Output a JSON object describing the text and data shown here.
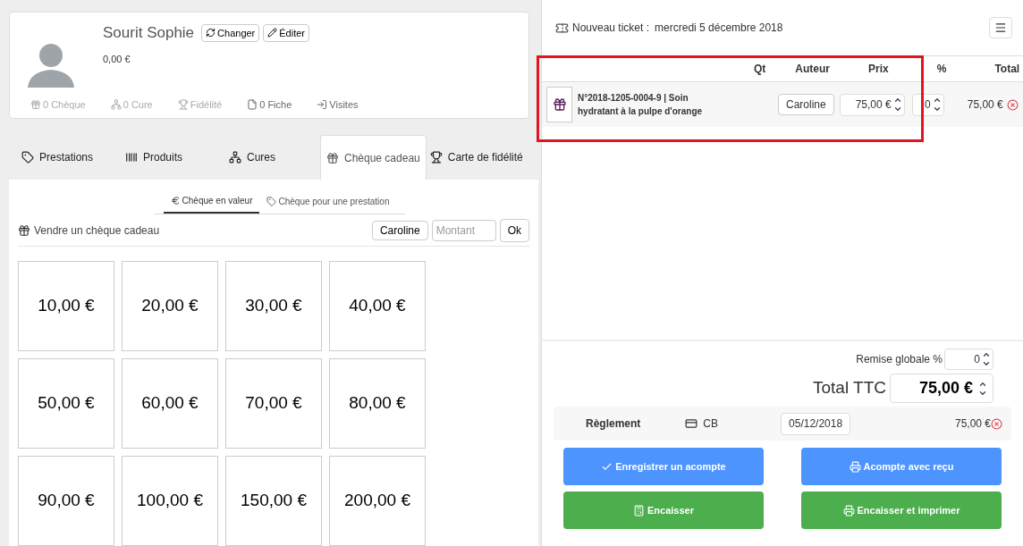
{
  "client": {
    "name": "Sourit Sophie",
    "balance": "0,00 €",
    "buttons": [
      {
        "kind": "change",
        "label": "Changer"
      },
      {
        "kind": "edit",
        "label": "Éditer"
      }
    ],
    "stats": [
      {
        "kind": "gift",
        "label": "0 Chèque",
        "disabled": true
      },
      {
        "kind": "tree",
        "label": "0 Cure",
        "disabled": true
      },
      {
        "kind": "trophy",
        "label": "Fidélité",
        "disabled": true
      },
      {
        "kind": "file",
        "label": "0 Fiche",
        "disabled": false
      },
      {
        "kind": "enter",
        "label": "Visites",
        "disabled": false
      }
    ]
  },
  "tabs": [
    {
      "kind": "tag",
      "label": "Prestations",
      "selected": false
    },
    {
      "kind": "barcode",
      "label": "Produits",
      "selected": false
    },
    {
      "kind": "tree",
      "label": "Cures",
      "selected": false
    },
    {
      "kind": "gift",
      "label": "Chèque cadeau",
      "selected": true
    },
    {
      "kind": "trophy",
      "label": "Carte de fidélité",
      "selected": false
    }
  ],
  "subtabs": [
    {
      "kind": "euro",
      "label": "Chèque en valeur",
      "selected": true
    },
    {
      "kind": "tag",
      "label": "Chèque pour une prestation",
      "selected": false
    }
  ],
  "sell": {
    "title": "Vendre un chèque cadeau",
    "author": "Caroline",
    "amount_placeholder": "Montant",
    "ok": "Ok"
  },
  "amounts": [
    "10,00 €",
    "20,00 €",
    "30,00 €",
    "40,00 €",
    "50,00 €",
    "60,00 €",
    "70,00 €",
    "80,00 €",
    "90,00 €",
    "100,00 €",
    "150,00 €",
    "200,00 €"
  ],
  "ticket": {
    "title": "Nouveau ticket :",
    "date": "mercredi 5 décembre 2018",
    "columns": [
      "Qt",
      "Auteur",
      "Prix",
      "%",
      "Total"
    ],
    "rows": [
      {
        "label": "N°2018-1205-0004-9 | Soin hydratant à la pulpe d'orange",
        "author": "Caroline",
        "price": "75,00 €",
        "discount": "0",
        "total": "75,00 €"
      }
    ]
  },
  "summary": {
    "discount_label": "Remise globale %",
    "discount": "0",
    "total_label": "Total TTC",
    "total": "75,00 €"
  },
  "payment": {
    "label": "Règlement",
    "method": "CB",
    "date": "05/12/2018",
    "amount": "75,00 €"
  },
  "actions": [
    {
      "kind": "deposit",
      "label": "Enregistrer un acompte"
    },
    {
      "kind": "deposit_print",
      "label": "Acompte avec reçu"
    },
    {
      "kind": "cash",
      "label": "Encaisser"
    },
    {
      "kind": "cash_print",
      "label": "Encaisser et imprimer"
    }
  ]
}
